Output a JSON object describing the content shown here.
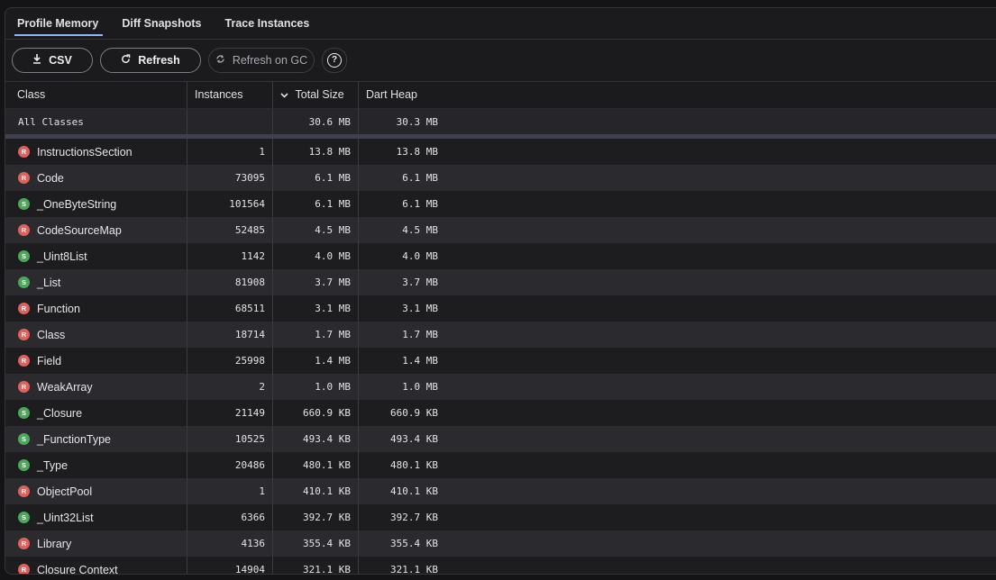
{
  "tabs": [
    {
      "label": "Profile Memory",
      "active": true
    },
    {
      "label": "Diff Snapshots",
      "active": false
    },
    {
      "label": "Trace Instances",
      "active": false
    }
  ],
  "toolbar": {
    "csv_label": "CSV",
    "csv_icon": "download-icon",
    "refresh_label": "Refresh",
    "refresh_icon": "refresh-icon",
    "gc_label": "Refresh on GC",
    "gc_icon": "autorenew-icon",
    "help_icon": "help-icon",
    "help_glyph": "?"
  },
  "table": {
    "headers": {
      "class": "Class",
      "instances": "Instances",
      "total_size": "Total Size",
      "dart_heap": "Dart Heap"
    },
    "sort_column": "total_size",
    "sort_direction": "descending",
    "all_classes": {
      "label": "All Classes",
      "instances": "",
      "total_size": "30.6 MB",
      "dart_heap": "30.3 MB"
    },
    "badge_colors": {
      "R": "#e0605c",
      "S": "#4ea65a"
    },
    "rows": [
      {
        "badge": "R",
        "name": "InstructionsSection",
        "instances": "1",
        "total_size": "13.8 MB",
        "dart_heap": "13.8 MB"
      },
      {
        "badge": "R",
        "name": "Code",
        "instances": "73095",
        "total_size": "6.1 MB",
        "dart_heap": "6.1 MB"
      },
      {
        "badge": "S",
        "name": "_OneByteString",
        "instances": "101564",
        "total_size": "6.1 MB",
        "dart_heap": "6.1 MB"
      },
      {
        "badge": "R",
        "name": "CodeSourceMap",
        "instances": "52485",
        "total_size": "4.5 MB",
        "dart_heap": "4.5 MB"
      },
      {
        "badge": "S",
        "name": "_Uint8List",
        "instances": "1142",
        "total_size": "4.0 MB",
        "dart_heap": "4.0 MB"
      },
      {
        "badge": "S",
        "name": "_List",
        "instances": "81908",
        "total_size": "3.7 MB",
        "dart_heap": "3.7 MB"
      },
      {
        "badge": "R",
        "name": "Function",
        "instances": "68511",
        "total_size": "3.1 MB",
        "dart_heap": "3.1 MB"
      },
      {
        "badge": "R",
        "name": "Class",
        "instances": "18714",
        "total_size": "1.7 MB",
        "dart_heap": "1.7 MB"
      },
      {
        "badge": "R",
        "name": "Field",
        "instances": "25998",
        "total_size": "1.4 MB",
        "dart_heap": "1.4 MB"
      },
      {
        "badge": "R",
        "name": "WeakArray",
        "instances": "2",
        "total_size": "1.0 MB",
        "dart_heap": "1.0 MB"
      },
      {
        "badge": "S",
        "name": "_Closure",
        "instances": "21149",
        "total_size": "660.9 KB",
        "dart_heap": "660.9 KB"
      },
      {
        "badge": "S",
        "name": "_FunctionType",
        "instances": "10525",
        "total_size": "493.4 KB",
        "dart_heap": "493.4 KB"
      },
      {
        "badge": "S",
        "name": "_Type",
        "instances": "20486",
        "total_size": "480.1 KB",
        "dart_heap": "480.1 KB"
      },
      {
        "badge": "R",
        "name": "ObjectPool",
        "instances": "1",
        "total_size": "410.1 KB",
        "dart_heap": "410.1 KB"
      },
      {
        "badge": "S",
        "name": "_Uint32List",
        "instances": "6366",
        "total_size": "392.7 KB",
        "dart_heap": "392.7 KB"
      },
      {
        "badge": "R",
        "name": "Library",
        "instances": "4136",
        "total_size": "355.4 KB",
        "dart_heap": "355.4 KB"
      },
      {
        "badge": "R",
        "name": "Closure Context",
        "instances": "14904",
        "total_size": "321.1 KB",
        "dart_heap": "321.1 KB"
      }
    ]
  }
}
